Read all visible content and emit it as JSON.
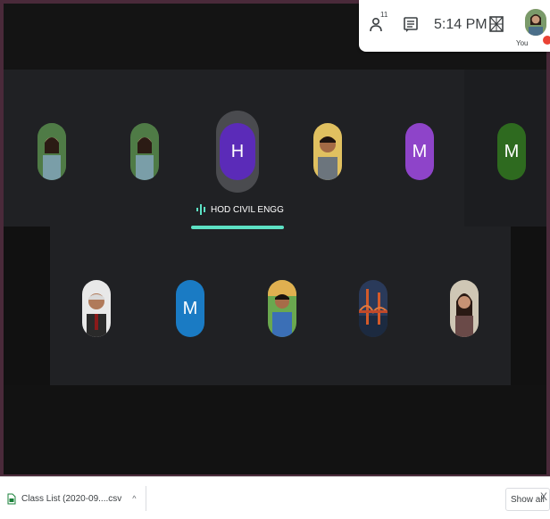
{
  "topbar": {
    "people_count": "11",
    "clock": "5:14 PM",
    "you_label": "You"
  },
  "meeting": {
    "active_speaker": {
      "initial": "H",
      "name": "HOD CIVIL ENGG",
      "color": "#5b2bb8"
    },
    "row1": [
      {
        "kind": "photo",
        "icon": "participant-photo-woman-floral"
      },
      {
        "kind": "photo",
        "icon": "participant-photo-woman-floral"
      },
      {
        "kind": "letter",
        "initial": "H",
        "color": "#5b2bb8"
      },
      {
        "kind": "photo",
        "icon": "participant-photo-man-yellow"
      },
      {
        "kind": "letter",
        "initial": "M",
        "color": "#8e44c9"
      },
      {
        "kind": "letter",
        "initial": "M",
        "color": "#2e6a1f"
      }
    ],
    "row2": [
      {
        "kind": "photo",
        "icon": "participant-photo-older-man"
      },
      {
        "kind": "letter",
        "initial": "M",
        "color": "#1a7bc4"
      },
      {
        "kind": "photo",
        "icon": "participant-photo-young-man"
      },
      {
        "kind": "photo",
        "icon": "participant-photo-golden-gate"
      },
      {
        "kind": "photo",
        "icon": "participant-photo-woman"
      }
    ]
  },
  "download_bar": {
    "file_label": "Class List (2020-09....csv",
    "show_all": "Show all",
    "close": "X"
  },
  "colors": {
    "meet_bg": "#202124",
    "speaker_indicator": "#5de1c4"
  }
}
